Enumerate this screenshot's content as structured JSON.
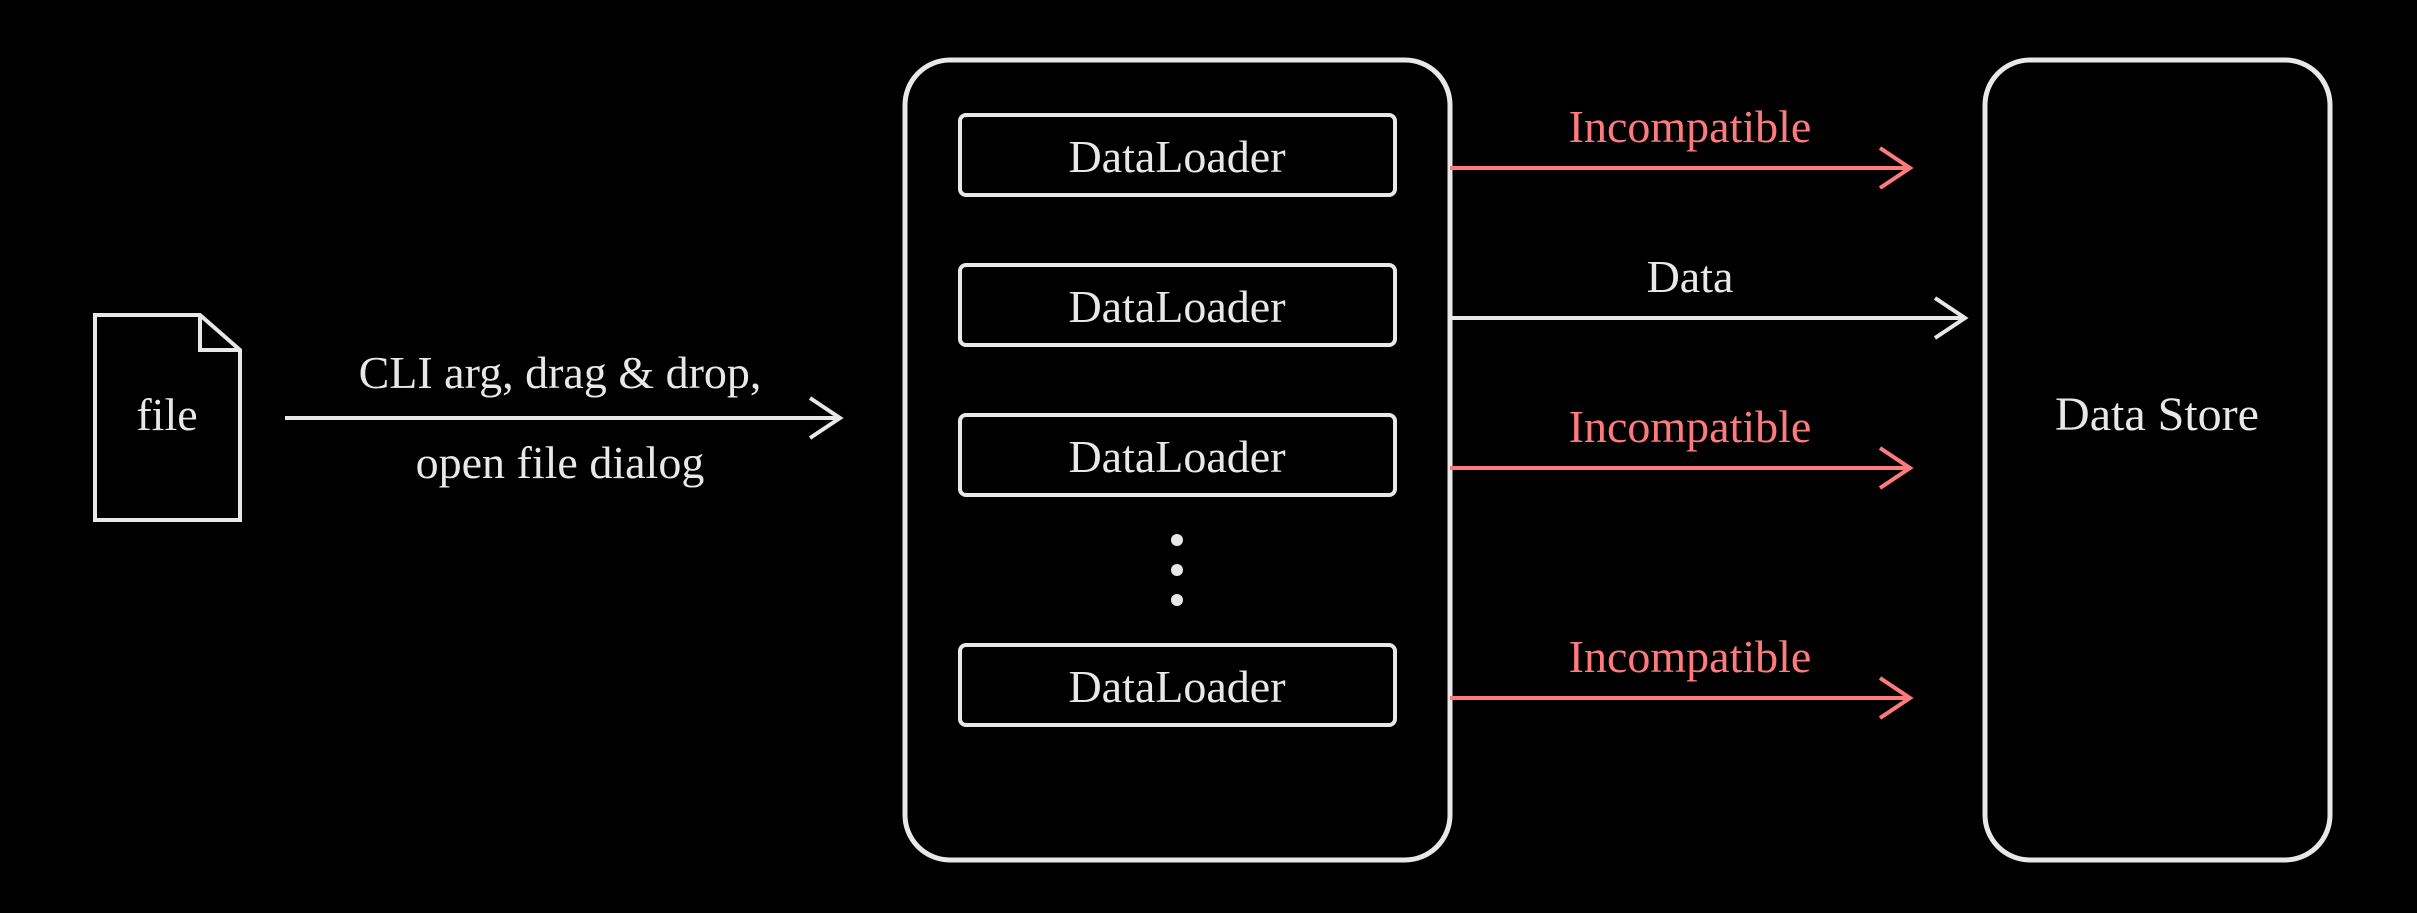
{
  "diagram": {
    "file_label": "file",
    "input_arrow_top": "CLI arg, drag & drop,",
    "input_arrow_bottom": "open file dialog",
    "loader_labels": [
      "DataLoader",
      "DataLoader",
      "DataLoader",
      "DataLoader"
    ],
    "output_arrows": [
      {
        "label": "Incompatible",
        "kind": "red"
      },
      {
        "label": "Data",
        "kind": "white"
      },
      {
        "label": "Incompatible",
        "kind": "red"
      },
      {
        "label": "Incompatible",
        "kind": "red"
      }
    ],
    "data_store_label": "Data Store"
  }
}
